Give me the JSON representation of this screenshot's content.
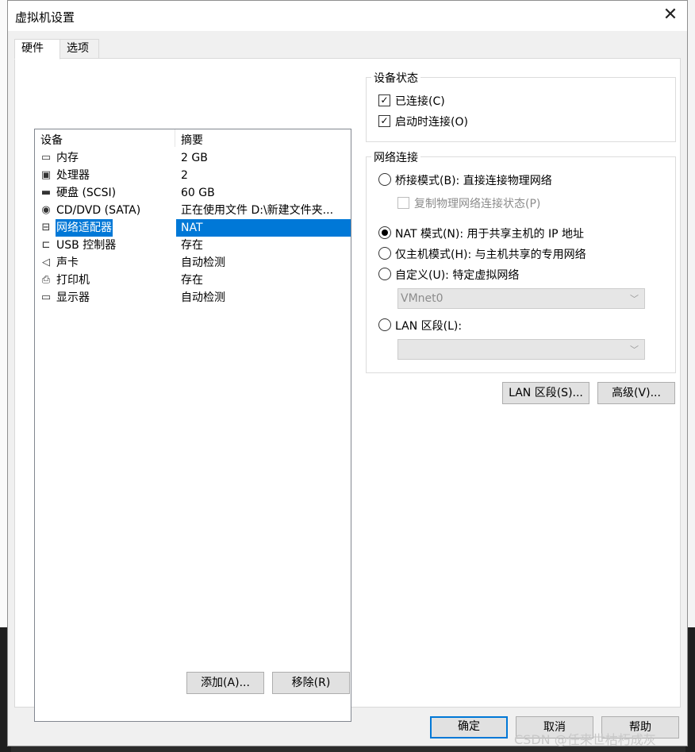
{
  "window": {
    "title": "虚拟机设置",
    "close_glyph": "✕"
  },
  "tabs": [
    {
      "label": "硬件",
      "active": true
    },
    {
      "label": "选项",
      "active": false
    }
  ],
  "device_list": {
    "headers": {
      "device": "设备",
      "summary": "摘要"
    },
    "rows": [
      {
        "icon": "memory-icon",
        "glyph": "▭",
        "device": "内存",
        "summary": "2 GB",
        "selected": false
      },
      {
        "icon": "processor-icon",
        "glyph": "▣",
        "device": "处理器",
        "summary": "2",
        "selected": false
      },
      {
        "icon": "hard-disk-icon",
        "glyph": "▬",
        "device": "硬盘 (SCSI)",
        "summary": "60 GB",
        "selected": false
      },
      {
        "icon": "cd-dvd-icon",
        "glyph": "◉",
        "device": "CD/DVD (SATA)",
        "summary": "正在使用文件 D:\\新建文件夹...",
        "selected": false
      },
      {
        "icon": "network-adapter-icon",
        "glyph": "⊟",
        "device": "网络适配器",
        "summary": "NAT",
        "selected": true
      },
      {
        "icon": "usb-icon",
        "glyph": "⊏",
        "device": "USB 控制器",
        "summary": "存在",
        "selected": false
      },
      {
        "icon": "sound-card-icon",
        "glyph": "◁",
        "device": "声卡",
        "summary": "自动检测",
        "selected": false
      },
      {
        "icon": "printer-icon",
        "glyph": "⎙",
        "device": "打印机",
        "summary": "存在",
        "selected": false
      },
      {
        "icon": "display-icon",
        "glyph": "▭",
        "device": "显示器",
        "summary": "自动检测",
        "selected": false
      }
    ]
  },
  "device_buttons": {
    "add": "添加(A)...",
    "remove": "移除(R)"
  },
  "device_status": {
    "title": "设备状态",
    "connected": {
      "label": "已连接(C)",
      "checked": true
    },
    "connect_at_power_on": {
      "label": "启动时连接(O)",
      "checked": true
    }
  },
  "network_connection": {
    "title": "网络连接",
    "bridged": {
      "label": "桥接模式(B): 直接连接物理网络",
      "selected": false
    },
    "replicate": {
      "label": "复制物理网络连接状态(P)",
      "checked": false,
      "disabled": true
    },
    "nat": {
      "label": "NAT 模式(N): 用于共享主机的 IP 地址",
      "selected": true
    },
    "host_only": {
      "label": "仅主机模式(H): 与主机共享的专用网络",
      "selected": false
    },
    "custom": {
      "label": "自定义(U): 特定虚拟网络",
      "selected": false
    },
    "custom_select": {
      "value": "VMnet0",
      "disabled": true
    },
    "lan_segment": {
      "label": "LAN 区段(L):",
      "selected": false
    },
    "lan_select": {
      "value": "",
      "disabled": true
    }
  },
  "network_buttons": {
    "lan_segments": "LAN 区段(S)...",
    "advanced": "高级(V)..."
  },
  "footer_buttons": {
    "ok": "确定",
    "cancel": "取消",
    "help": "帮助"
  },
  "watermark": "CSDN @任来世枯朽成灰",
  "colors": {
    "selection": "#0078d7",
    "dialog_bg": "#f0f0f0",
    "panel_bg": "#ffffff"
  }
}
